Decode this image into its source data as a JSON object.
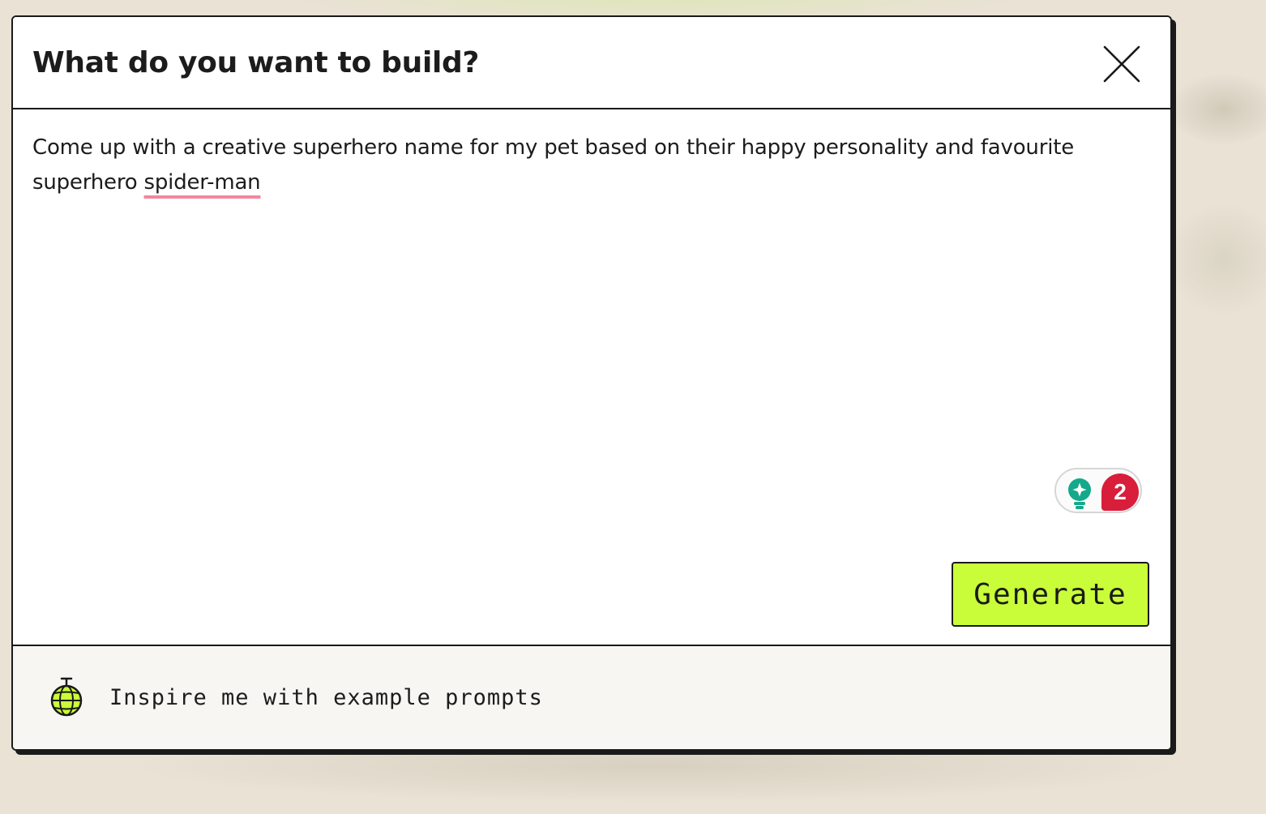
{
  "dialog": {
    "title": "What do you want to build?",
    "close_icon": "close-icon"
  },
  "prompt": {
    "text_before": "Come up with a creative superhero name for my pet based on their happy personality and favourite superhero ",
    "misspelled_word": "spider-man"
  },
  "grammar_widget": {
    "icon": "lightbulb-icon",
    "alert_count": "2",
    "colors": {
      "bulb": "#13a98a",
      "badge": "#d81e3a"
    }
  },
  "actions": {
    "generate_label": "Generate",
    "generate_color": "#c9fd39"
  },
  "footer": {
    "icon": "disco-ball-icon",
    "inspire_label": "Inspire me with example prompts"
  }
}
